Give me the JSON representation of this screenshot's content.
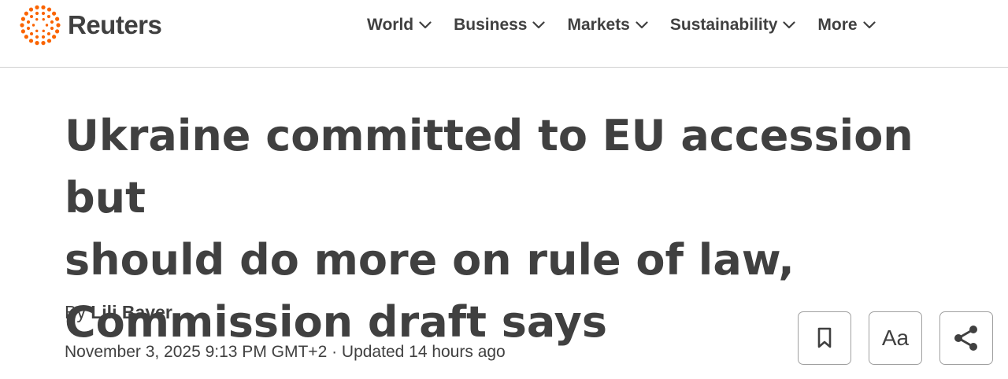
{
  "brand": {
    "name": "Reuters",
    "accent_color": "#fa6400",
    "logo_icon": "reuters-dots-logo-icon"
  },
  "nav": {
    "items": [
      {
        "label": "World",
        "icon": "chevron-down-icon"
      },
      {
        "label": "Business",
        "icon": "chevron-down-icon"
      },
      {
        "label": "Markets",
        "icon": "chevron-down-icon"
      },
      {
        "label": "Sustainability",
        "icon": "chevron-down-icon"
      },
      {
        "label": "More",
        "icon": "chevron-down-icon"
      }
    ]
  },
  "article": {
    "headline_lines": [
      "Ukraine committed to EU accession but",
      "should do more on rule of law,",
      "Commission draft says"
    ],
    "byline_prefix": "By",
    "author": "Lili Bayer",
    "dateline": "November 3, 2025 9:13 PM GMT+2 · Updated 14 hours ago"
  },
  "tools": {
    "bookmark_icon": "bookmark-icon",
    "text_size_label": "Aa",
    "share_icon": "share-icon"
  }
}
